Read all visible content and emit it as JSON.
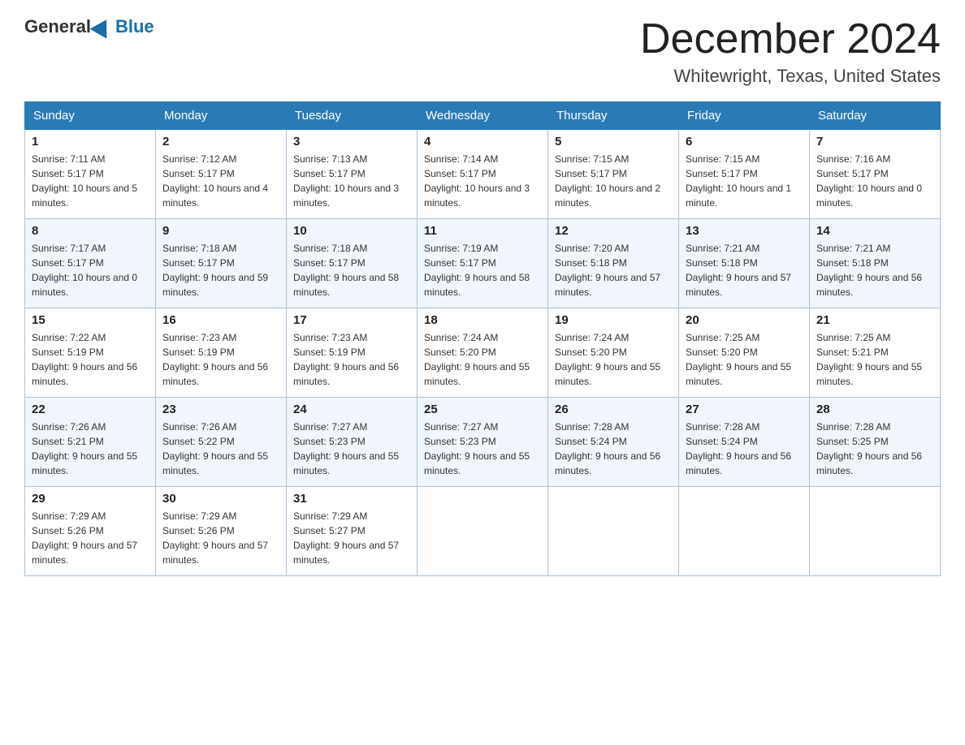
{
  "header": {
    "logo_general": "General",
    "logo_blue": "Blue",
    "month_title": "December 2024",
    "location": "Whitewright, Texas, United States"
  },
  "days_of_week": [
    "Sunday",
    "Monday",
    "Tuesday",
    "Wednesday",
    "Thursday",
    "Friday",
    "Saturday"
  ],
  "weeks": [
    [
      {
        "day": "1",
        "sunrise": "7:11 AM",
        "sunset": "5:17 PM",
        "daylight": "10 hours and 5 minutes."
      },
      {
        "day": "2",
        "sunrise": "7:12 AM",
        "sunset": "5:17 PM",
        "daylight": "10 hours and 4 minutes."
      },
      {
        "day": "3",
        "sunrise": "7:13 AM",
        "sunset": "5:17 PM",
        "daylight": "10 hours and 3 minutes."
      },
      {
        "day": "4",
        "sunrise": "7:14 AM",
        "sunset": "5:17 PM",
        "daylight": "10 hours and 3 minutes."
      },
      {
        "day": "5",
        "sunrise": "7:15 AM",
        "sunset": "5:17 PM",
        "daylight": "10 hours and 2 minutes."
      },
      {
        "day": "6",
        "sunrise": "7:15 AM",
        "sunset": "5:17 PM",
        "daylight": "10 hours and 1 minute."
      },
      {
        "day": "7",
        "sunrise": "7:16 AM",
        "sunset": "5:17 PM",
        "daylight": "10 hours and 0 minutes."
      }
    ],
    [
      {
        "day": "8",
        "sunrise": "7:17 AM",
        "sunset": "5:17 PM",
        "daylight": "10 hours and 0 minutes."
      },
      {
        "day": "9",
        "sunrise": "7:18 AM",
        "sunset": "5:17 PM",
        "daylight": "9 hours and 59 minutes."
      },
      {
        "day": "10",
        "sunrise": "7:18 AM",
        "sunset": "5:17 PM",
        "daylight": "9 hours and 58 minutes."
      },
      {
        "day": "11",
        "sunrise": "7:19 AM",
        "sunset": "5:17 PM",
        "daylight": "9 hours and 58 minutes."
      },
      {
        "day": "12",
        "sunrise": "7:20 AM",
        "sunset": "5:18 PM",
        "daylight": "9 hours and 57 minutes."
      },
      {
        "day": "13",
        "sunrise": "7:21 AM",
        "sunset": "5:18 PM",
        "daylight": "9 hours and 57 minutes."
      },
      {
        "day": "14",
        "sunrise": "7:21 AM",
        "sunset": "5:18 PM",
        "daylight": "9 hours and 56 minutes."
      }
    ],
    [
      {
        "day": "15",
        "sunrise": "7:22 AM",
        "sunset": "5:19 PM",
        "daylight": "9 hours and 56 minutes."
      },
      {
        "day": "16",
        "sunrise": "7:23 AM",
        "sunset": "5:19 PM",
        "daylight": "9 hours and 56 minutes."
      },
      {
        "day": "17",
        "sunrise": "7:23 AM",
        "sunset": "5:19 PM",
        "daylight": "9 hours and 56 minutes."
      },
      {
        "day": "18",
        "sunrise": "7:24 AM",
        "sunset": "5:20 PM",
        "daylight": "9 hours and 55 minutes."
      },
      {
        "day": "19",
        "sunrise": "7:24 AM",
        "sunset": "5:20 PM",
        "daylight": "9 hours and 55 minutes."
      },
      {
        "day": "20",
        "sunrise": "7:25 AM",
        "sunset": "5:20 PM",
        "daylight": "9 hours and 55 minutes."
      },
      {
        "day": "21",
        "sunrise": "7:25 AM",
        "sunset": "5:21 PM",
        "daylight": "9 hours and 55 minutes."
      }
    ],
    [
      {
        "day": "22",
        "sunrise": "7:26 AM",
        "sunset": "5:21 PM",
        "daylight": "9 hours and 55 minutes."
      },
      {
        "day": "23",
        "sunrise": "7:26 AM",
        "sunset": "5:22 PM",
        "daylight": "9 hours and 55 minutes."
      },
      {
        "day": "24",
        "sunrise": "7:27 AM",
        "sunset": "5:23 PM",
        "daylight": "9 hours and 55 minutes."
      },
      {
        "day": "25",
        "sunrise": "7:27 AM",
        "sunset": "5:23 PM",
        "daylight": "9 hours and 55 minutes."
      },
      {
        "day": "26",
        "sunrise": "7:28 AM",
        "sunset": "5:24 PM",
        "daylight": "9 hours and 56 minutes."
      },
      {
        "day": "27",
        "sunrise": "7:28 AM",
        "sunset": "5:24 PM",
        "daylight": "9 hours and 56 minutes."
      },
      {
        "day": "28",
        "sunrise": "7:28 AM",
        "sunset": "5:25 PM",
        "daylight": "9 hours and 56 minutes."
      }
    ],
    [
      {
        "day": "29",
        "sunrise": "7:29 AM",
        "sunset": "5:26 PM",
        "daylight": "9 hours and 57 minutes."
      },
      {
        "day": "30",
        "sunrise": "7:29 AM",
        "sunset": "5:26 PM",
        "daylight": "9 hours and 57 minutes."
      },
      {
        "day": "31",
        "sunrise": "7:29 AM",
        "sunset": "5:27 PM",
        "daylight": "9 hours and 57 minutes."
      },
      null,
      null,
      null,
      null
    ]
  ],
  "sunrise_label": "Sunrise:",
  "sunset_label": "Sunset:",
  "daylight_label": "Daylight:"
}
